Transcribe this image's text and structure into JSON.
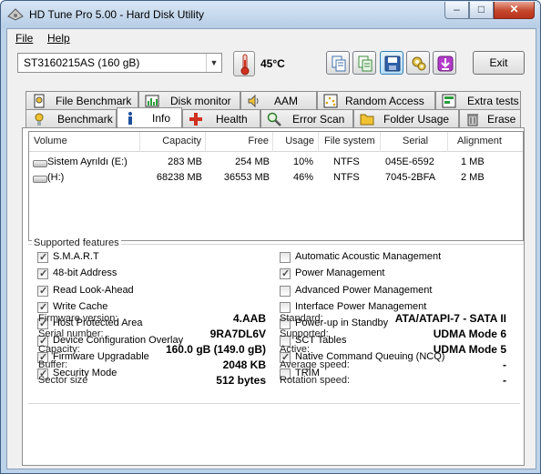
{
  "window": {
    "title": "HD Tune Pro 5.00 - Hard Disk Utility",
    "minimize_label": "–",
    "maximize_label": "□",
    "close_label": "✕"
  },
  "menu": {
    "file_label": "File",
    "help_label": "Help"
  },
  "toolbar": {
    "drive_selected": "ST3160215AS (160 gB)",
    "temperature": "45°C",
    "exit_label": "Exit",
    "icons": [
      "copy-icon",
      "copy-all-icon",
      "save-icon",
      "options-icon",
      "download-icon"
    ]
  },
  "tabs": {
    "row_top": [
      "File Benchmark",
      "Disk monitor",
      "AAM",
      "Random Access",
      "Extra tests"
    ],
    "row_bottom": [
      "Benchmark",
      "Info",
      "Health",
      "Error Scan",
      "Folder Usage",
      "Erase"
    ],
    "selected": "Info"
  },
  "volumes": {
    "headers": [
      "Volume",
      "Capacity",
      "Free",
      "Usage",
      "File system",
      "Serial",
      "Alignment"
    ],
    "rows": [
      [
        "Sistem Ayrıldı (E:)",
        "283 MB",
        "254 MB",
        "10%",
        "NTFS",
        "045E-6592",
        "1 MB"
      ],
      [
        "(H:)",
        "68238 MB",
        "36553 MB",
        "46%",
        "NTFS",
        "7045-2BFA",
        "2 MB"
      ]
    ]
  },
  "features": {
    "title": "Supported features",
    "left": [
      {
        "label": "S.M.A.R.T",
        "checked": true
      },
      {
        "label": "48-bit Address",
        "checked": true
      },
      {
        "label": "Read Look-Ahead",
        "checked": true
      },
      {
        "label": "Write Cache",
        "checked": true
      },
      {
        "label": "Host Protected Area",
        "checked": true
      },
      {
        "label": "Device Configuration Overlay",
        "checked": true
      },
      {
        "label": "Firmware Upgradable",
        "checked": true
      },
      {
        "label": "Security Mode",
        "checked": true
      }
    ],
    "right": [
      {
        "label": "Automatic Acoustic Management",
        "checked": false
      },
      {
        "label": "Power Management",
        "checked": true
      },
      {
        "label": "Advanced Power Management",
        "checked": false
      },
      {
        "label": "Interface Power Management",
        "checked": false
      },
      {
        "label": "Power-up in Standby",
        "checked": false
      },
      {
        "label": "SCT Tables",
        "checked": false
      },
      {
        "label": "Native Command Queuing (NCQ)",
        "checked": true
      },
      {
        "label": "TRIM",
        "checked": false
      }
    ]
  },
  "info": {
    "left": [
      {
        "label": "Firmware version:",
        "value": "4.AAB"
      },
      {
        "label": "Serial number:",
        "value": "9RA7DL6V"
      },
      {
        "label": "Capacity:",
        "value": "160.0 gB (149.0 gB)"
      },
      {
        "label": "Buffer:",
        "value": "2048 KB"
      },
      {
        "label": "Sector size",
        "value": "512 bytes"
      }
    ],
    "right": [
      {
        "label": "Standard:",
        "value": "ATA/ATAPI-7 - SATA II"
      },
      {
        "label": "Supported:",
        "value": "UDMA Mode 6"
      },
      {
        "label": "Active:",
        "value": "UDMA Mode 5"
      },
      {
        "label": "Average speed:",
        "value": "-"
      },
      {
        "label": "Rotation speed:",
        "value": "-"
      }
    ]
  },
  "colors": {
    "title_gradient_top": "#d8e6f5",
    "close_button": "#c5472c",
    "panel_bg": "#f0f0f0"
  }
}
